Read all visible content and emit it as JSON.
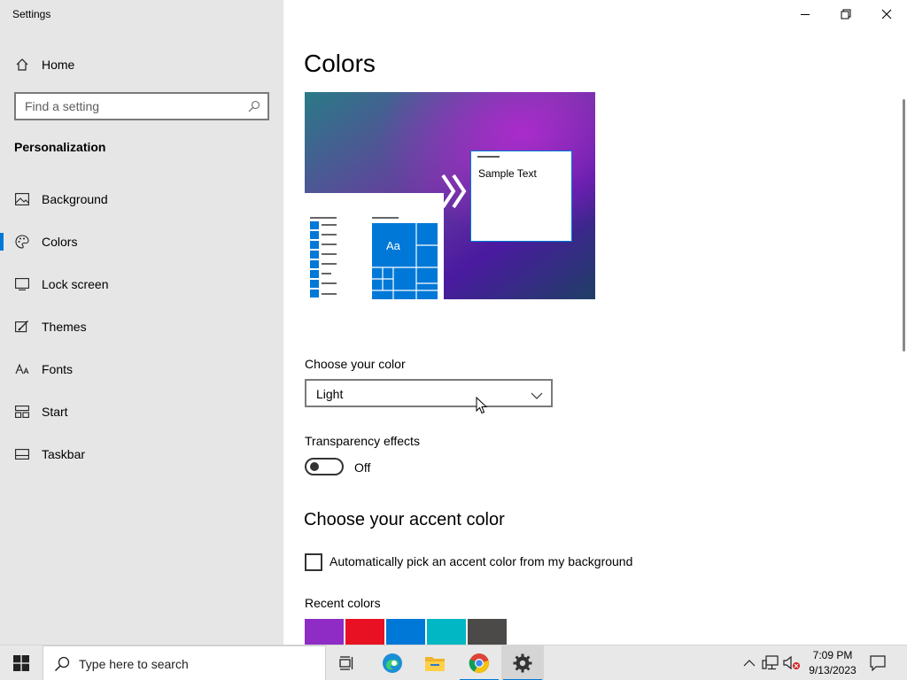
{
  "window": {
    "title": "Settings"
  },
  "sidebar": {
    "home_label": "Home",
    "search_placeholder": "Find a setting",
    "section_title": "Personalization",
    "items": [
      {
        "label": "Background",
        "icon": "picture-icon"
      },
      {
        "label": "Colors",
        "icon": "palette-icon",
        "selected": true
      },
      {
        "label": "Lock screen",
        "icon": "lock-screen-icon"
      },
      {
        "label": "Themes",
        "icon": "brush-icon"
      },
      {
        "label": "Fonts",
        "icon": "font-icon"
      },
      {
        "label": "Start",
        "icon": "start-layout-icon"
      },
      {
        "label": "Taskbar",
        "icon": "taskbar-icon"
      }
    ]
  },
  "main": {
    "page_title": "Colors",
    "preview": {
      "sample_text": "Sample Text",
      "tile_text": "Aa"
    },
    "choose_color": {
      "label": "Choose your color",
      "selected": "Light"
    },
    "transparency": {
      "label": "Transparency effects",
      "state": "Off"
    },
    "accent": {
      "title": "Choose your accent color",
      "auto_pick_label": "Automatically pick an accent color from my background",
      "auto_pick_checked": false,
      "recent_label": "Recent colors",
      "recent_colors": [
        "#8e2cc5",
        "#e81123",
        "#0078d7",
        "#00b7c3",
        "#4c4a48"
      ]
    }
  },
  "taskbar": {
    "search_placeholder": "Type here to search",
    "apps": [
      "task-view-icon",
      "edge-icon",
      "file-explorer-icon",
      "chrome-icon",
      "settings-gear-icon"
    ],
    "clock_time": "7:09 PM",
    "clock_date": "9/13/2023"
  },
  "colors": {
    "accent": "#0078d7",
    "sidebar_bg": "#e6e6e6",
    "taskbar_bg": "#e8e8e8"
  }
}
